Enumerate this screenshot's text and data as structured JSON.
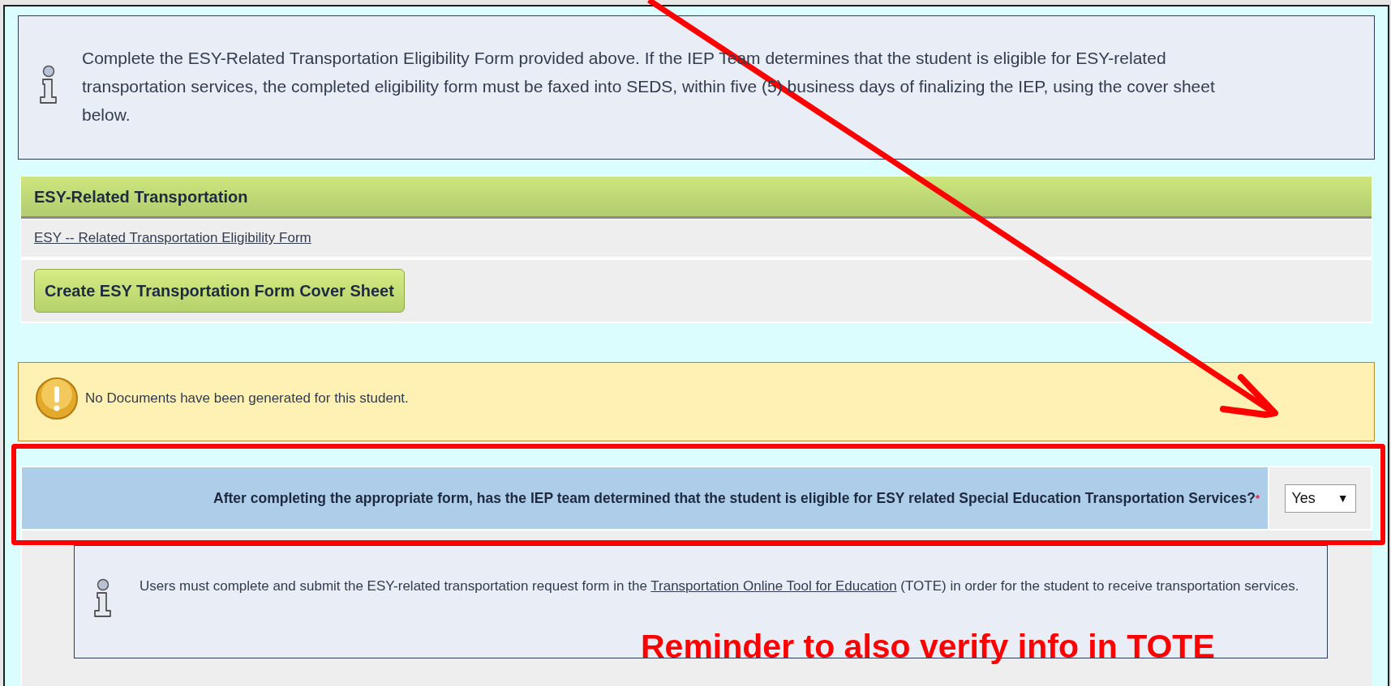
{
  "info_note": {
    "text": "Complete the ESY-Related Transportation Eligibility Form provided above. If the IEP Team determines that the student is eligible for ESY-related transportation services, the completed eligibility form must be faxed into SEDS, within five (5) business days of finalizing the IEP, using the cover sheet below."
  },
  "section": {
    "title": "ESY-Related Transportation",
    "link": "ESY -- Related Transportation Eligibility Form",
    "button": "Create ESY Transportation Form Cover Sheet"
  },
  "warning": {
    "text": "No Documents have been generated for this student."
  },
  "question": {
    "label": "After completing the appropriate form, has the IEP team determined that the student is eligible for ESY related Special Education Transportation Services?",
    "required_mark": "*",
    "value": "Yes",
    "caret": "▼"
  },
  "tote_note": {
    "before": "Users must complete and submit the ESY-related transportation request form in the",
    "link": "Transportation Online Tool for Education",
    "after": "(TOTE) in order for the student to receive transportation services."
  },
  "annotation": {
    "text": "Reminder to also verify info in TOTE"
  }
}
